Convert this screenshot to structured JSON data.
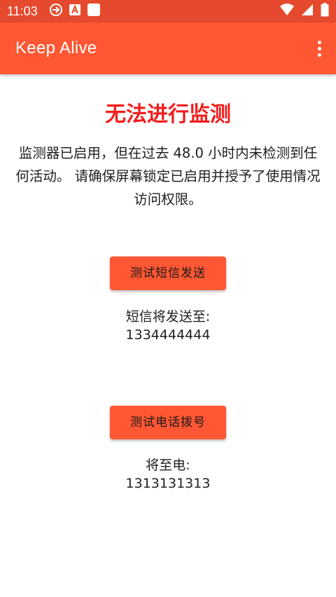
{
  "status_bar": {
    "time": "11:03",
    "left_icons": [
      "sync-icon",
      "text-a-icon",
      "square-notification-icon"
    ],
    "right_icons": [
      "wifi-icon",
      "cell-signal-icon",
      "battery-icon"
    ],
    "background_color": "#e64a2e"
  },
  "app_bar": {
    "title": "Keep Alive",
    "menu_icon": "overflow-menu-icon",
    "background_color": "#ff5733"
  },
  "main": {
    "alert_title": "无法进行监测",
    "alert_title_color": "#f21d1d",
    "alert_message": "监测器已启用，但在过去 48.0 小时内未检测到任何活动。 请确保屏幕锁定已启用并授予了使用情况访问权限。",
    "sms": {
      "button_label": "测试短信发送",
      "target_label": "短信将发送至:",
      "target_number": "1334444444"
    },
    "call": {
      "button_label": "测试电话拨号",
      "target_label": "将至电:",
      "target_number": "1313131313"
    },
    "button_color": "#ff5733"
  }
}
